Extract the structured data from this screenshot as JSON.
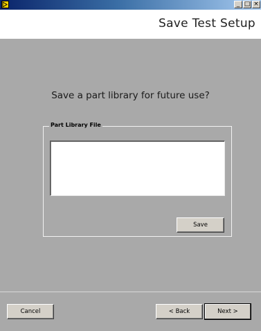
{
  "window": {
    "minimize_glyph": "_",
    "maximize_glyph": "□",
    "close_glyph": "×"
  },
  "header": {
    "title": "Save Test Setup"
  },
  "main": {
    "prompt": "Save a part library for future use?",
    "group_label": "Part Library File",
    "file_value": "",
    "save_label": "Save"
  },
  "footer": {
    "cancel_label": "Cancel",
    "back_label": "< Back",
    "next_label": "Next >"
  },
  "colors": {
    "panel": "#a9a9a9",
    "button_face": "#d4d0c8",
    "titlebar_start": "#0a246a",
    "icon_yellow": "#f4d000"
  }
}
